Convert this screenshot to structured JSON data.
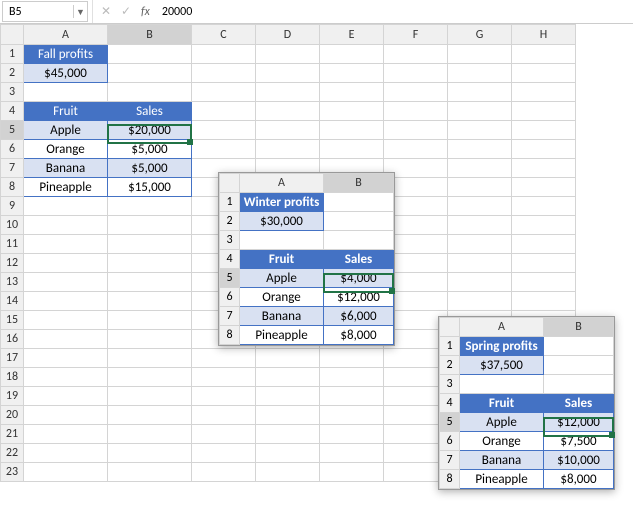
{
  "formula_bar": {
    "name_box": "B5",
    "cancel": "✕",
    "accept": "✓",
    "fx": "fx",
    "value": "20000"
  },
  "main": {
    "cols": [
      "A",
      "B",
      "C",
      "D",
      "E",
      "F",
      "G",
      "H"
    ],
    "rows": [
      "1",
      "2",
      "3",
      "4",
      "5",
      "6",
      "7",
      "8",
      "9",
      "10",
      "11",
      "12",
      "13",
      "14",
      "15",
      "16",
      "17",
      "18",
      "19",
      "20",
      "21",
      "22",
      "23"
    ],
    "title": "Fall profits",
    "total": "$45,000",
    "th_fruit": "Fruit",
    "th_sales": "Sales",
    "r5a": "Apple",
    "r5b": "$20,000",
    "r6a": "Orange",
    "r6b": "$5,000",
    "r7a": "Banana",
    "r7b": "$5,000",
    "r8a": "Pineapple",
    "r8b": "$15,000"
  },
  "winter": {
    "title": "Winter profits",
    "total": "$30,000",
    "th_fruit": "Fruit",
    "th_sales": "Sales",
    "r5a": "Apple",
    "r5b": "$4,000",
    "r6a": "Orange",
    "r6b": "$12,000",
    "r7a": "Banana",
    "r7b": "$6,000",
    "r8a": "Pineapple",
    "r8b": "$8,000"
  },
  "spring": {
    "title": "Spring profits",
    "total": "$37,500",
    "th_fruit": "Fruit",
    "th_sales": "Sales",
    "r5a": "Apple",
    "r5b": "$12,000",
    "r6a": "Orange",
    "r6b": "$7,500",
    "r7a": "Banana",
    "r7b": "$10,000",
    "r8a": "Pineapple",
    "r8b": "$8,000"
  },
  "chart_data": [
    {
      "type": "table",
      "title": "Fall profits",
      "total": 45000,
      "columns": [
        "Fruit",
        "Sales"
      ],
      "rows": [
        [
          "Apple",
          20000
        ],
        [
          "Orange",
          5000
        ],
        [
          "Banana",
          5000
        ],
        [
          "Pineapple",
          15000
        ]
      ]
    },
    {
      "type": "table",
      "title": "Winter profits",
      "total": 30000,
      "columns": [
        "Fruit",
        "Sales"
      ],
      "rows": [
        [
          "Apple",
          4000
        ],
        [
          "Orange",
          12000
        ],
        [
          "Banana",
          6000
        ],
        [
          "Pineapple",
          8000
        ]
      ]
    },
    {
      "type": "table",
      "title": "Spring profits",
      "total": 37500,
      "columns": [
        "Fruit",
        "Sales"
      ],
      "rows": [
        [
          "Apple",
          12000
        ],
        [
          "Orange",
          7500
        ],
        [
          "Banana",
          10000
        ],
        [
          "Pineapple",
          8000
        ]
      ]
    }
  ]
}
